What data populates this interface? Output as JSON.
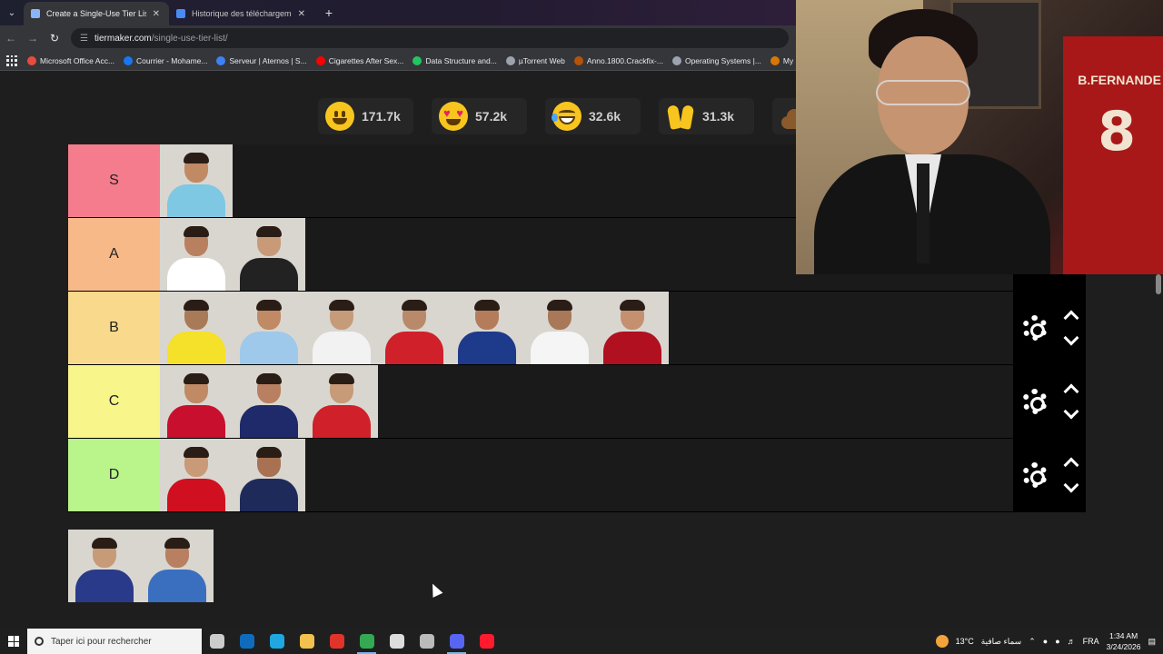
{
  "browser": {
    "tabs": [
      {
        "title": "Create a Single-Use Tier List (P",
        "active": true
      },
      {
        "title": "Historique des téléchargements",
        "active": false
      }
    ],
    "url_host": "tiermaker.com",
    "url_path": "/single-use-tier-list/",
    "bookmarks": [
      {
        "label": "Microsoft Office Acc...",
        "color": "#e74c3c"
      },
      {
        "label": "Courrier - Mohame...",
        "color": "#1877f2"
      },
      {
        "label": "Serveur | Aternos | S...",
        "color": "#3b82f6"
      },
      {
        "label": "Cigarettes After Sex...",
        "color": "#ff0000"
      },
      {
        "label": "Data Structure and...",
        "color": "#22c55e"
      },
      {
        "label": "µTorrent Web",
        "color": "#9ca3af"
      },
      {
        "label": "Anno.1800.Crackfix-...",
        "color": "#b45309"
      },
      {
        "label": "Operating Systems |...",
        "color": "#9ca3af"
      },
      {
        "label": "My",
        "color": "#d97706"
      }
    ]
  },
  "reactions": [
    {
      "icon": "smile-emoji-icon",
      "count": "171.7k"
    },
    {
      "icon": "heart-eyes-emoji-icon",
      "count": "57.2k"
    },
    {
      "icon": "laughing-emoji-icon",
      "count": "32.6k"
    },
    {
      "icon": "raised-hands-emoji-icon",
      "count": "31.3k"
    },
    {
      "icon": "poop-emoji-icon",
      "count": ""
    }
  ],
  "tiers": [
    {
      "label": "S",
      "color": "#f47c8c",
      "items": [
        {
          "skin": "#c08a65",
          "shirt": "#7ec8e3"
        }
      ]
    },
    {
      "label": "A",
      "color": "#f8b989",
      "items": [
        {
          "skin": "#b98060",
          "shirt": "#ffffff"
        },
        {
          "skin": "#c99a78",
          "shirt": "#222222"
        }
      ]
    },
    {
      "label": "B",
      "color": "#f9d98b",
      "items": [
        {
          "skin": "#a97a58",
          "shirt": "#f5e02a"
        },
        {
          "skin": "#c08a65",
          "shirt": "#9ec9ea"
        },
        {
          "skin": "#c69b7a",
          "shirt": "#f2f2f2"
        },
        {
          "skin": "#b98a6a",
          "shirt": "#d0202a"
        },
        {
          "skin": "#b57c5c",
          "shirt": "#1e3a8a"
        },
        {
          "skin": "#a87858",
          "shirt": "#f5f5f5"
        },
        {
          "skin": "#c49070",
          "shirt": "#b01020"
        }
      ]
    },
    {
      "label": "C",
      "color": "#f8f58a",
      "items": [
        {
          "skin": "#c08a65",
          "shirt": "#c8102e"
        },
        {
          "skin": "#b88060",
          "shirt": "#1e2a6a"
        },
        {
          "skin": "#c79a78",
          "shirt": "#d0202a"
        }
      ]
    },
    {
      "label": "D",
      "color": "#b9f58a",
      "items": [
        {
          "skin": "#c99a78",
          "shirt": "#d01020"
        },
        {
          "skin": "#a87252",
          "shirt": "#1e2a5a"
        }
      ]
    }
  ],
  "bank": [
    {
      "skin": "#c79a78",
      "shirt": "#2a3a8a"
    },
    {
      "skin": "#b88060",
      "shirt": "#3a6fc0"
    }
  ],
  "webcam": {
    "jersey_name": "B.FERNANDE",
    "jersey_number": "8"
  },
  "taskbar": {
    "search_placeholder": "Taper ici pour rechercher",
    "apps": [
      {
        "icon": "task-view-icon",
        "color": "#cccccc",
        "active": false
      },
      {
        "icon": "outlook-icon",
        "color": "#0f6cbd",
        "active": false
      },
      {
        "icon": "edge-icon",
        "color": "#1fa8e0",
        "active": false
      },
      {
        "icon": "file-explorer-icon",
        "color": "#f2c14e",
        "active": false
      },
      {
        "icon": "office-icon",
        "color": "#e0342a",
        "active": false
      },
      {
        "icon": "chrome-icon",
        "color": "#34a853",
        "active": true
      },
      {
        "icon": "steam-icon",
        "color": "#dddddd",
        "active": false
      },
      {
        "icon": "obs-icon",
        "color": "#bbbbbb",
        "active": false
      },
      {
        "icon": "discord-icon",
        "color": "#5865f2",
        "active": true
      },
      {
        "icon": "opera-icon",
        "color": "#ff1b2d",
        "active": false
      }
    ],
    "temperature": "13°C",
    "weather_text": "سماء صافية",
    "language": "FRA",
    "time": "1:34 AM",
    "date": "3/24/2026"
  }
}
